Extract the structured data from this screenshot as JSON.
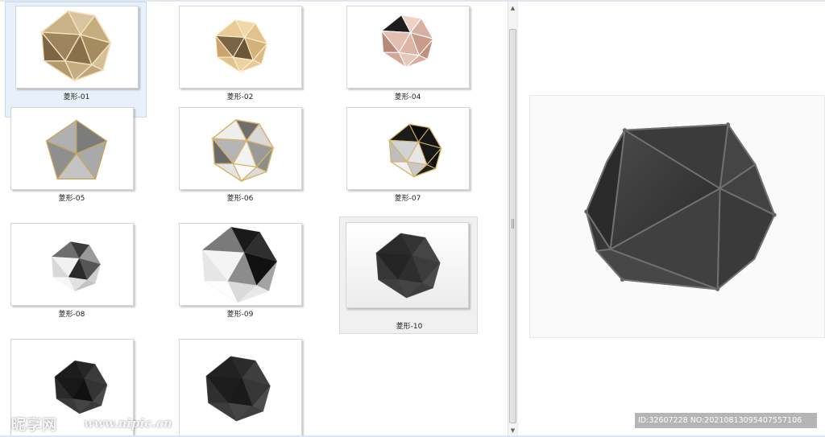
{
  "files": [
    {
      "label": "菱形-01",
      "state": "selected",
      "style": "gold"
    },
    {
      "label": "菱形-02",
      "state": "normal",
      "style": "gold2"
    },
    {
      "label": "菱形-04",
      "state": "normal",
      "style": "rose"
    },
    {
      "label": "菱形-05",
      "state": "normal",
      "style": "graygold"
    },
    {
      "label": "菱形-06",
      "state": "normal",
      "style": "silvergold"
    },
    {
      "label": "菱形-07",
      "state": "normal",
      "style": "blackgold"
    },
    {
      "label": "菱形-08",
      "state": "normal",
      "style": "silver"
    },
    {
      "label": "菱形-09",
      "state": "normal",
      "style": "silverbig"
    },
    {
      "label": "菱形-10",
      "state": "hover",
      "style": "dark"
    },
    {
      "label": "",
      "state": "normal",
      "style": "dark"
    },
    {
      "label": "",
      "state": "normal",
      "style": "dark"
    }
  ],
  "icons": {
    "scroll_up": "scroll-up-arrow-icon",
    "scroll_down": "scroll-down-arrow-icon"
  },
  "watermark": {
    "logo": "昵享网",
    "url": "www.nipic.cn",
    "id_text": "ID:32607228 NO:20210813095407557106"
  },
  "colors": {
    "selection": "#e8f1fb",
    "hover": "#f0f0f0",
    "accent_gold": "#c9a96e"
  }
}
